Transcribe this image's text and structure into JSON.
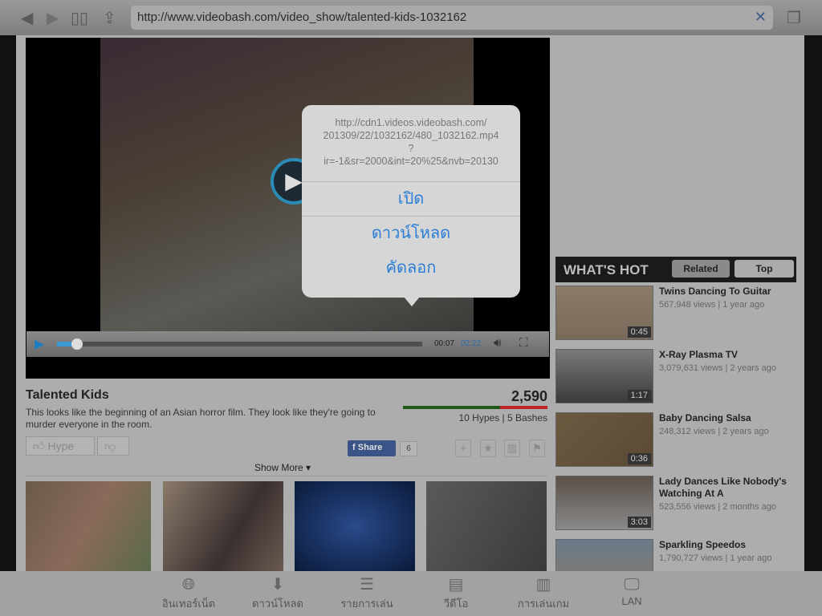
{
  "browser": {
    "url": "http://www.videobash.com/video_show/talented-kids-1032162"
  },
  "player": {
    "current_time": "00:07",
    "total_time": "02:22",
    "progress_percent": 5
  },
  "popup": {
    "url": "http://cdn1.videos.videobash.com/\n201309/22/1032162/480_1032162.mp4\n?\nir=-1&sr=2000&int=20%25&nvb=20130",
    "actions": [
      "เปิด",
      "ดาวน์โหลด",
      "คัดลอก"
    ]
  },
  "video": {
    "title": "Talented Kids",
    "description": "This looks like the beginning of an Asian horror film. They look like they're going to murder everyone in the room.",
    "score": "2,590",
    "hypes_bashes": "10 Hypes | 5 Bashes",
    "hype_fraction": 0.67,
    "hype_label": "Hype",
    "share_label": "Share",
    "share_count": "6",
    "show_more": "Show More"
  },
  "sidebar": {
    "heading": "WHAT'S HOT",
    "tabs": [
      "Related",
      "Top"
    ],
    "items": [
      {
        "title": "Twins Dancing To Guitar",
        "meta": "567,948 views | 1 year ago",
        "duration": "0:45"
      },
      {
        "title": "X-Ray Plasma TV",
        "meta": "3,079,631 views | 2 years ago",
        "duration": "1:17"
      },
      {
        "title": "Baby Dancing Salsa",
        "meta": "248,312 views | 2 years ago",
        "duration": "0:36"
      },
      {
        "title": "Lady Dances Like Nobody's Watching At A",
        "meta": "523,556 views | 2 months ago",
        "duration": "3:03"
      },
      {
        "title": "Sparkling Speedos",
        "meta": "1,790,727 views | 1 year ago",
        "duration": ""
      }
    ]
  },
  "toolbar": [
    "อินเทอร์เน็ต",
    "ดาวน์โหลด",
    "รายการเล่น",
    "วีดีโอ",
    "การเล่นเกม",
    "LAN"
  ]
}
